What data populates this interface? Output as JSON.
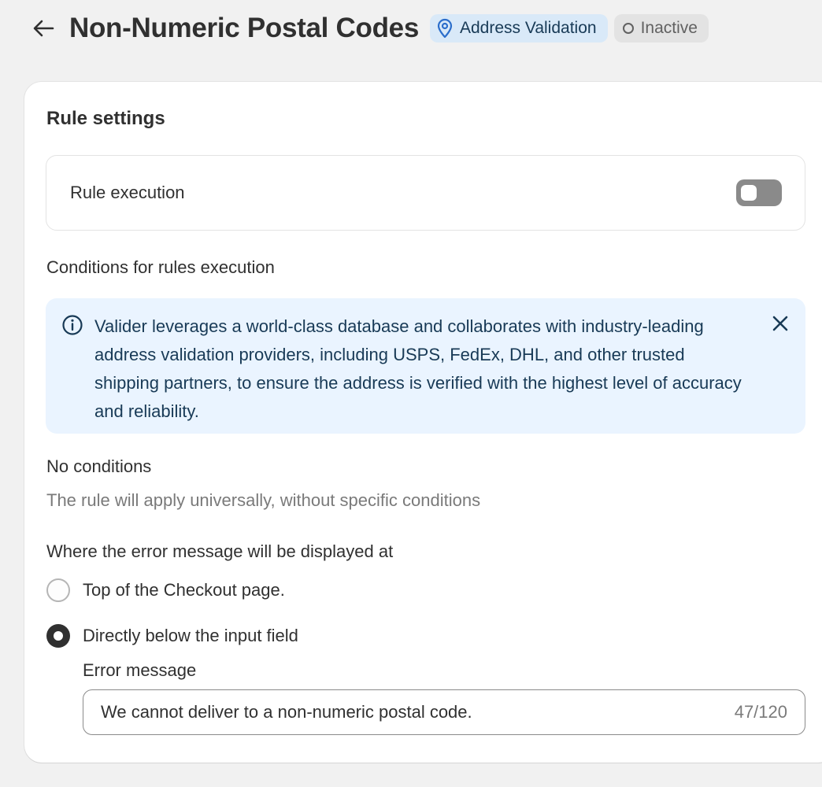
{
  "header": {
    "back_icon": "arrow-left-icon",
    "title": "Non-Numeric Postal Codes",
    "category_badge": {
      "label": "Address Validation",
      "icon": "location-pin-icon",
      "color": "#2c6ecb"
    },
    "status_badge": {
      "label": "Inactive",
      "icon": "circle-outline-icon"
    }
  },
  "card": {
    "title": "Rule settings",
    "rule_execution": {
      "label": "Rule execution",
      "enabled": false
    },
    "conditions": {
      "label": "Conditions for rules execution",
      "info_banner": {
        "icon": "info-icon",
        "text": "Valider leverages a world-class database and collaborates with industry-leading address validation providers, including USPS, FedEx, DHL, and other trusted shipping partners, to ensure the address is verified with the highest level of accuracy and reliability.",
        "close_icon": "close-icon"
      },
      "none_title": "No conditions",
      "none_description": "The rule will apply universally, without specific conditions"
    },
    "error_display": {
      "label": "Where the error message will be displayed at",
      "options": [
        {
          "label": "Top of the Checkout page.",
          "selected": false
        },
        {
          "label": "Directly below the input field",
          "selected": true
        }
      ],
      "message_label": "Error message",
      "message_value": "We cannot deliver to a non-numeric postal code.",
      "char_count": "47/120"
    }
  }
}
